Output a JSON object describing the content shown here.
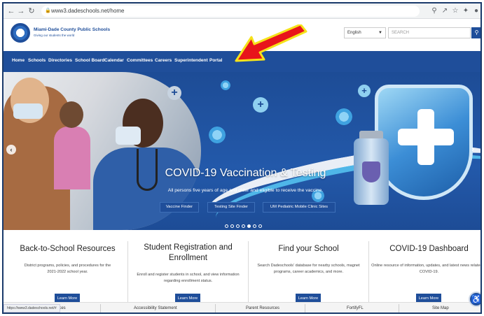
{
  "browser": {
    "url": "www3.dadeschools.net/home",
    "icons": [
      "back-icon",
      "forward-icon",
      "reload-icon",
      "lock-icon",
      "zoom-icon",
      "share-icon",
      "star-icon",
      "extensions-icon",
      "profile-icon"
    ]
  },
  "header": {
    "logo_title": "Miami-Dade County Public Schools",
    "logo_subtitle": "Giving our students the world",
    "language": "English",
    "search_placeholder": "SEARCH"
  },
  "nav": {
    "items": [
      "Home",
      "Schools",
      "Directories",
      "School Board",
      "Calendar",
      "Committees",
      "Careers",
      "Superintendent",
      "Portal"
    ]
  },
  "hero": {
    "title": "COVID-19 Vaccination & Testing",
    "subtitle": "All persons five years of age and older and eligible to receive the vaccine.",
    "buttons": [
      "Vaccine Finder",
      "Testing Site Finder",
      "UM Pediatric Mobile Clinic Sites"
    ],
    "slide_count": 7,
    "active_slide": 5
  },
  "cards": [
    {
      "title": "Back-to-School Resources",
      "desc": "District programs, policies, and procedures for the 2021-2022 school year.",
      "button": "Learn More"
    },
    {
      "title": "Student Registration and Enrollment",
      "desc": "Enroll and register students in school, and view information regarding enrollment status.",
      "button": "Learn More"
    },
    {
      "title": "Find your School",
      "desc": "Search Dadeschools' database for nearby schools, magnet programs, career academics, and more.",
      "button": "Learn More"
    },
    {
      "title": "COVID-19 Dashboard",
      "desc": "Online resource of information, updates, and latest news related to COVID-19.",
      "button": "Learn More"
    }
  ],
  "footer": {
    "items": [
      "Resources",
      "Accessibility Statement",
      "Parent Resources",
      "FortifyFL",
      "Site Map"
    ]
  },
  "status_bar_url": "https://www3.dadeschools.net/#",
  "colors": {
    "brand_blue": "#1f4e9a",
    "annotation_arrow": "#e8141b",
    "annotation_arrow_outline": "#f5e21a"
  }
}
